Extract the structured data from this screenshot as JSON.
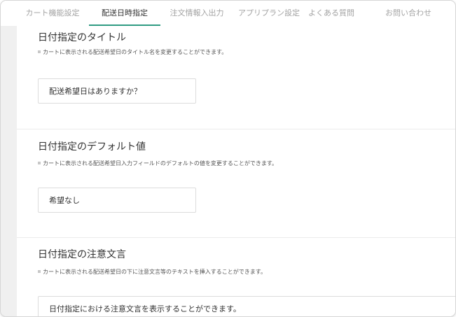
{
  "tabs": [
    {
      "label": "カート機能設定",
      "active": false
    },
    {
      "label": "配送日時指定",
      "active": true
    },
    {
      "label": "注文情報入出力",
      "active": false
    },
    {
      "label": "アプリプラン設定",
      "active": false
    },
    {
      "label": "よくある質問",
      "active": false
    },
    {
      "label": "お問い合わせ",
      "active": false
    }
  ],
  "sections": [
    {
      "title": "日付指定のタイトル",
      "description": "カートに表示される配送希望日のタイトル名を変更することができます。",
      "value": "配送希望日はありますか？"
    },
    {
      "title": "日付指定のデフォルト値",
      "description": "カートに表示される配送希望日入力フィールドのデフォルトの値を変更することができます。",
      "value": "希望なし"
    },
    {
      "title": "日付指定の注意文言",
      "description": "カートに表示される配送希望日の下に注意文言等のテキストを挿入することができます。",
      "value": "日付指定における注意文言を表示することができます。"
    }
  ],
  "colors": {
    "accent": "#2f9b82",
    "sidebar": "#f0f0f0"
  }
}
